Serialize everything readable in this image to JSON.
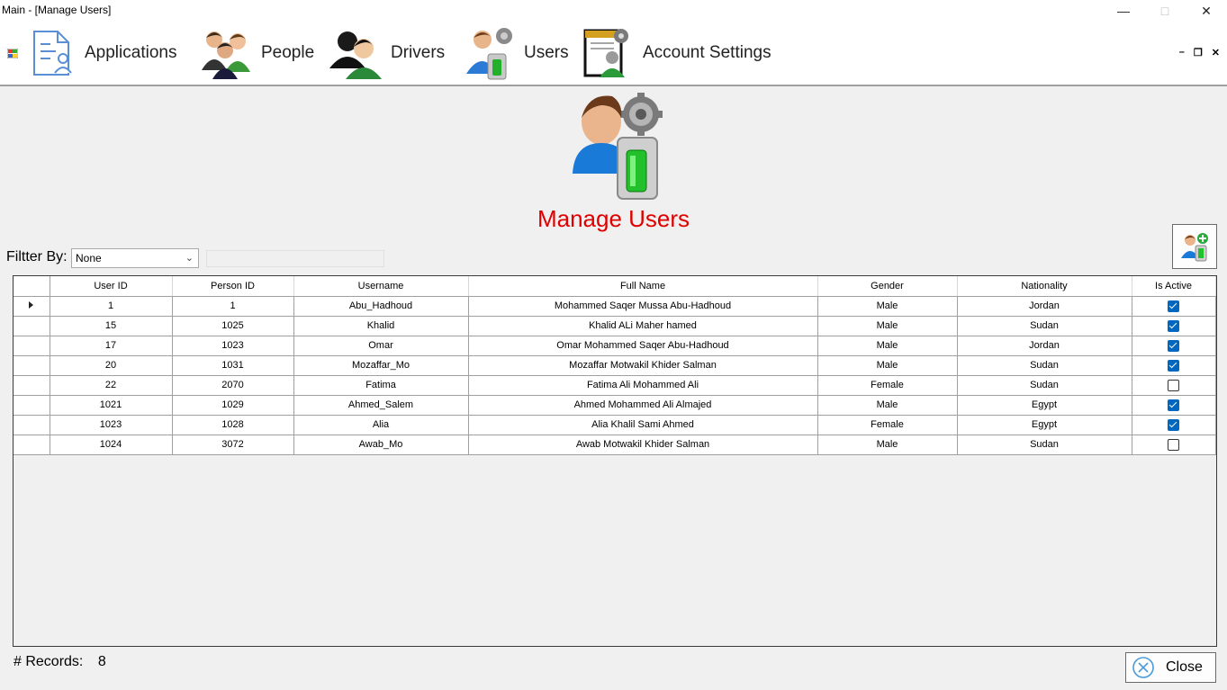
{
  "window": {
    "title": "Main - [Manage Users]",
    "minimize": "—",
    "maximize": "□",
    "close": "✕"
  },
  "menu": {
    "items": [
      {
        "label": "Applications",
        "icon": "applications-document-icon"
      },
      {
        "label": "People",
        "icon": "people-icon"
      },
      {
        "label": "Drivers",
        "icon": "drivers-icon"
      },
      {
        "label": "Users",
        "icon": "users-icon"
      },
      {
        "label": "Account Settings",
        "icon": "account-settings-icon"
      }
    ],
    "mdi_buttons": [
      "–",
      "❐",
      "✕"
    ]
  },
  "header": {
    "title": "Manage Users",
    "icon": "manage-users-icon"
  },
  "filter": {
    "label": "Filtter By:",
    "selected": "None",
    "text_value": ""
  },
  "grid": {
    "columns": [
      "User ID",
      "Person ID",
      "Username",
      "Full Name",
      "Gender",
      "Nationality",
      "Is Active"
    ],
    "rows": [
      {
        "user_id": "1",
        "person_id": "1",
        "username": "Abu_Hadhoud",
        "full_name": "Mohammed Saqer Mussa Abu-Hadhoud",
        "gender": "Male",
        "nationality": "Jordan",
        "is_active": true
      },
      {
        "user_id": "15",
        "person_id": "1025",
        "username": "Khalid",
        "full_name": "Khalid ALi Maher hamed",
        "gender": "Male",
        "nationality": "Sudan",
        "is_active": true
      },
      {
        "user_id": "17",
        "person_id": "1023",
        "username": "Omar",
        "full_name": "Omar Mohammed Saqer Abu-Hadhoud",
        "gender": "Male",
        "nationality": "Jordan",
        "is_active": true
      },
      {
        "user_id": "20",
        "person_id": "1031",
        "username": "Mozaffar_Mo",
        "full_name": "Mozaffar Motwakil Khider Salman",
        "gender": "Male",
        "nationality": "Sudan",
        "is_active": true
      },
      {
        "user_id": "22",
        "person_id": "2070",
        "username": "Fatima",
        "full_name": "Fatima Ali Mohammed Ali",
        "gender": "Female",
        "nationality": "Sudan",
        "is_active": false
      },
      {
        "user_id": "1021",
        "person_id": "1029",
        "username": "Ahmed_Salem",
        "full_name": "Ahmed Mohammed Ali Almajed",
        "gender": "Male",
        "nationality": "Egypt",
        "is_active": true
      },
      {
        "user_id": "1023",
        "person_id": "1028",
        "username": "Alia",
        "full_name": "Alia Khalil Sami Ahmed",
        "gender": "Female",
        "nationality": "Egypt",
        "is_active": true
      },
      {
        "user_id": "1024",
        "person_id": "3072",
        "username": "Awab_Mo",
        "full_name": "Awab Motwakil Khider Salman",
        "gender": "Male",
        "nationality": "Sudan",
        "is_active": false
      }
    ]
  },
  "footer": {
    "records_label": "# Records:",
    "records_count": "8",
    "close_label": "Close"
  },
  "colors": {
    "title_red": "#e00000",
    "checkbox_blue": "#0067c0"
  }
}
